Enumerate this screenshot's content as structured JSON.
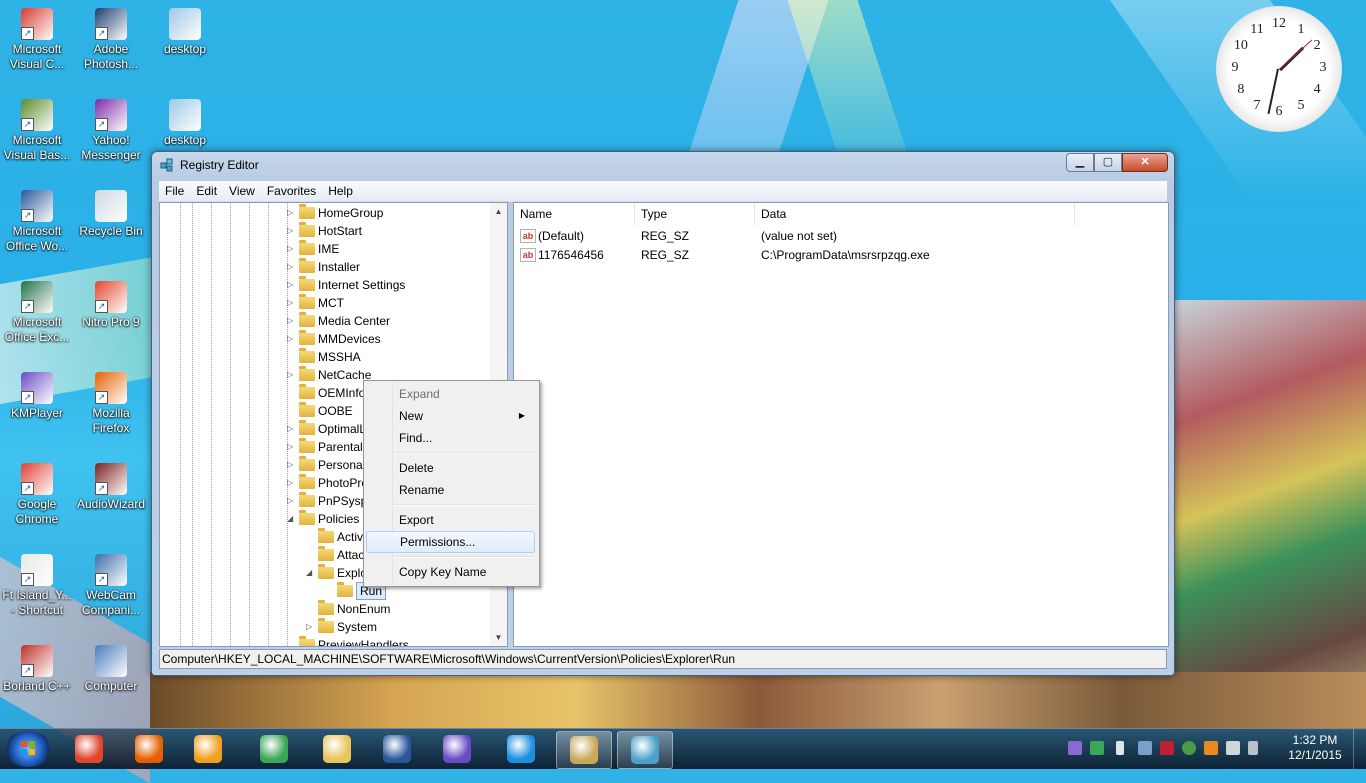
{
  "desktop_icons": [
    {
      "label": "Microsoft Visual C...",
      "color": "#d63a2f"
    },
    {
      "label": "Adobe Photosh...",
      "color": "#1c3d6e"
    },
    {
      "label": "desktop",
      "color": "#9ec8e6"
    },
    {
      "label": "Microsoft Visual Bas...",
      "color": "#5a8c2a"
    },
    {
      "label": "Yahoo! Messenger",
      "color": "#7b2aa8"
    },
    {
      "label": "desktop",
      "color": "#9ec8e6"
    },
    {
      "label": "Microsoft Office Wo...",
      "color": "#2b579a"
    },
    {
      "label": "Recycle Bin",
      "color": "#cfd8df"
    },
    {
      "label": "Microsoft Office Exc...",
      "color": "#217346"
    },
    {
      "label": "Nitro Pro 9",
      "color": "#e2452b"
    },
    {
      "label": "KMPlayer",
      "color": "#6a4bc4"
    },
    {
      "label": "Mozilla Firefox",
      "color": "#e66000"
    },
    {
      "label": "Google Chrome",
      "color": "#e0402f"
    },
    {
      "label": "AudioWizard",
      "color": "#7a2020"
    },
    {
      "label": "Ft Island_Y... - Shortcut",
      "color": "#e8e8e8"
    },
    {
      "label": "WebCam Compani...",
      "color": "#3a6ea8"
    },
    {
      "label": "Borland C++",
      "color": "#c0302a"
    },
    {
      "label": "Computer",
      "color": "#4a7cc0"
    }
  ],
  "clock_gadget": {
    "numbers": [
      "12",
      "1",
      "2",
      "3",
      "4",
      "5",
      "6",
      "7",
      "8",
      "9",
      "10",
      "11"
    ]
  },
  "window": {
    "title": "Registry Editor",
    "menu": [
      "File",
      "Edit",
      "View",
      "Favorites",
      "Help"
    ],
    "tree": [
      {
        "label": "HomeGroup",
        "level": 0,
        "expandable": true
      },
      {
        "label": "HotStart",
        "level": 0,
        "expandable": true
      },
      {
        "label": "IME",
        "level": 0,
        "expandable": true
      },
      {
        "label": "Installer",
        "level": 0,
        "expandable": true
      },
      {
        "label": "Internet Settings",
        "level": 0,
        "expandable": true
      },
      {
        "label": "MCT",
        "level": 0,
        "expandable": true
      },
      {
        "label": "Media Center",
        "level": 0,
        "expandable": true
      },
      {
        "label": "MMDevices",
        "level": 0,
        "expandable": true
      },
      {
        "label": "MSSHA",
        "level": 0,
        "expandable": false
      },
      {
        "label": "NetCache",
        "level": 0,
        "expandable": true
      },
      {
        "label": "OEMInfo",
        "level": 0,
        "expandable": false
      },
      {
        "label": "OOBE",
        "level": 0,
        "expandable": false
      },
      {
        "label": "OptimalL",
        "level": 0,
        "expandable": true
      },
      {
        "label": "Parental",
        "level": 0,
        "expandable": true
      },
      {
        "label": "Personal",
        "level": 0,
        "expandable": true
      },
      {
        "label": "PhotoPro",
        "level": 0,
        "expandable": true
      },
      {
        "label": "PnPSysp",
        "level": 0,
        "expandable": true
      },
      {
        "label": "Policies",
        "level": 0,
        "expandable": true,
        "expanded": true
      },
      {
        "label": "Activ",
        "level": 1,
        "expandable": false
      },
      {
        "label": "Attac",
        "level": 1,
        "expandable": false
      },
      {
        "label": "Explo",
        "level": 1,
        "expandable": true,
        "expanded": true
      },
      {
        "label": "Run",
        "level": 2,
        "expandable": false,
        "selected": true
      },
      {
        "label": "NonEnum",
        "level": 1,
        "expandable": false
      },
      {
        "label": "System",
        "level": 1,
        "expandable": true
      },
      {
        "label": "PreviewHandlers",
        "level": 0,
        "expandable": false
      }
    ],
    "columns": [
      "Name",
      "Type",
      "Data"
    ],
    "values": [
      {
        "name": "(Default)",
        "type": "REG_SZ",
        "data": "(value not set)"
      },
      {
        "name": "1176546456",
        "type": "REG_SZ",
        "data": "C:\\ProgramData\\msrsrpzqg.exe"
      }
    ],
    "status": "Computer\\HKEY_LOCAL_MACHINE\\SOFTWARE\\Microsoft\\Windows\\CurrentVersion\\Policies\\Explorer\\Run"
  },
  "context_menu": [
    {
      "label": "Expand",
      "disabled": true
    },
    {
      "label": "New",
      "submenu": true
    },
    {
      "label": "Find..."
    },
    {
      "separator": true
    },
    {
      "label": "Delete"
    },
    {
      "label": "Rename"
    },
    {
      "separator": true
    },
    {
      "label": "Export"
    },
    {
      "label": "Permissions...",
      "highlighted": true
    },
    {
      "separator": true
    },
    {
      "label": "Copy Key Name"
    }
  ],
  "taskbar": {
    "apps": [
      {
        "name": "nitro-pro-icon",
        "color": "#e2452b"
      },
      {
        "name": "firefox-icon",
        "color": "#e66000"
      },
      {
        "name": "kmplayer-icon",
        "color": "#f0a020"
      },
      {
        "name": "chrome-icon",
        "color": "#3aa757"
      },
      {
        "name": "explorer-icon",
        "color": "#e8c45a"
      },
      {
        "name": "word-icon",
        "color": "#2b579a"
      },
      {
        "name": "media-icon",
        "color": "#6a4bc4"
      },
      {
        "name": "ie-icon",
        "color": "#1b8fe0"
      },
      {
        "name": "paint-icon",
        "color": "#c9a95a"
      },
      {
        "name": "regedit-icon",
        "color": "#4aa0c8"
      }
    ],
    "time": "1:32 PM",
    "date": "12/1/2015"
  }
}
